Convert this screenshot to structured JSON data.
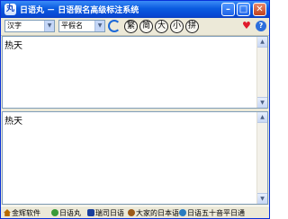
{
  "window": {
    "title": "日语丸 － 日语假名高级标注系统",
    "min_glyph": "–",
    "max_glyph": "□",
    "close_glyph": "✕"
  },
  "toolbar": {
    "source_select": "汉字",
    "target_select": "平假名",
    "dropdown_glyph": "▼",
    "circle_buttons": [
      "繁",
      "简",
      "大",
      "小",
      "拼"
    ],
    "heart_glyph": "♥",
    "help_glyph": "?"
  },
  "editor": {
    "input_text": "热天",
    "output_text": "热天",
    "scroll_up": "▲",
    "scroll_down": "▼"
  },
  "links": [
    "金辉软件",
    "日语丸",
    "瑞司日语",
    "大家的日本语",
    "日语五十音平日通"
  ],
  "app_icon_glyph": "丸"
}
